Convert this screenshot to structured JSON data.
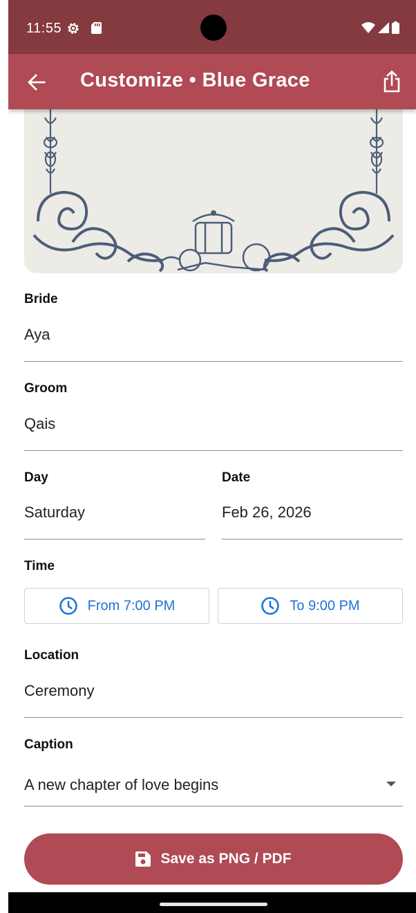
{
  "status_bar": {
    "time": "11:55"
  },
  "app_bar": {
    "title": "Customize • Blue Grace"
  },
  "form": {
    "bride": {
      "label": "Bride",
      "value": "Aya"
    },
    "groom": {
      "label": "Groom",
      "value": "Qais"
    },
    "day": {
      "label": "Day",
      "value": "Saturday"
    },
    "date": {
      "label": "Date",
      "value": "Feb 26, 2026"
    },
    "time": {
      "label": "Time",
      "from_label": "From 7:00 PM",
      "to_label": "To 9:00 PM"
    },
    "location": {
      "label": "Location",
      "value": "Ceremony"
    },
    "caption": {
      "label": "Caption",
      "value": "A new chapter of love begins"
    }
  },
  "actions": {
    "save_label": "Save as PNG / PDF"
  },
  "colors": {
    "status_bar": "#853a40",
    "app_bar": "#b04a55",
    "button": "#b04a55",
    "time_accent": "#1f73d9",
    "ornament": "#4c5d78"
  },
  "icons": {
    "back": "arrow-back-icon",
    "share": "share-icon",
    "clock": "clock-icon",
    "save": "save-icon",
    "dropdown": "dropdown-arrow-icon",
    "status": [
      "settings-gear-icon",
      "sd-card-icon",
      "wifi-icon",
      "cell-signal-icon",
      "battery-icon"
    ]
  }
}
